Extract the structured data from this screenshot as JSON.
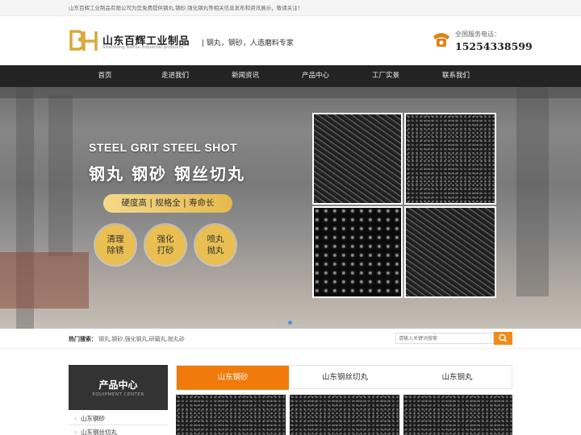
{
  "topbar": {
    "notice": "山东百辉工业制品有限公司为您免费提供钢丸,钢砂,强化钢丸等相关信息发布和资讯展示，敬请关注！"
  },
  "header": {
    "company_name": "山东百辉工业制品",
    "company_en": "Shandong Baihui industrial products",
    "slogan": "| 钢丸，钢砂，人造磨料专家",
    "hotline_label": "全国服务电话：",
    "hotline_number": "15254338599"
  },
  "nav": {
    "items": [
      "首页",
      "走进我们",
      "新闻资讯",
      "产品中心",
      "工厂实景",
      "联系我们"
    ]
  },
  "banner": {
    "headline_en": "STEEL GRIT STEEL SHOT",
    "headline_cn": "钢丸 钢砂 钢丝切丸",
    "features": "硬度高 | 规格全 | 寿命长",
    "circles": [
      {
        "line1": "清理",
        "line2": "除锈"
      },
      {
        "line1": "强化",
        "line2": "打砂"
      },
      {
        "line1": "喷丸",
        "line2": "抛丸"
      }
    ],
    "slide_count": 3,
    "active_slide": 2
  },
  "hot_search": {
    "label": "热门搜索：",
    "keywords": "钢丸,钢砂,强化钢丸,研磨丸,抛丸砂",
    "search_placeholder": "请输入关键词搜索"
  },
  "products": {
    "center_title": "产品中心",
    "center_subtitle": "EQUIPMENT CENTER",
    "categories": [
      "山东钢砂",
      "山东钢丝切丸"
    ],
    "tabs": [
      "山东钢砂",
      "山东钢丝切丸",
      "山东钢丸"
    ],
    "active_tab": 0
  },
  "colors": {
    "accent": "#f07b0c",
    "nav_bg": "#232323",
    "gold": "#e9bf52"
  }
}
